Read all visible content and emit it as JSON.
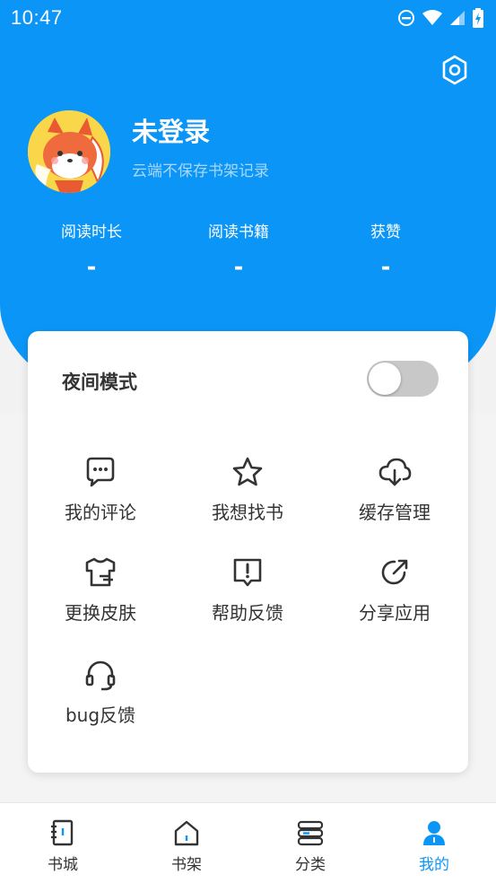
{
  "status_bar": {
    "time": "10:47"
  },
  "profile": {
    "username": "未登录",
    "subtitle": "云端不保存书架记录",
    "stats": [
      {
        "label": "阅读时长",
        "value": "-"
      },
      {
        "label": "阅读书籍",
        "value": "-"
      },
      {
        "label": "获赞",
        "value": "-"
      }
    ]
  },
  "card": {
    "night_mode_label": "夜间模式",
    "night_mode_on": false,
    "items": [
      {
        "label": "我的评论",
        "icon": "comment-icon"
      },
      {
        "label": "我想找书",
        "icon": "star-icon"
      },
      {
        "label": "缓存管理",
        "icon": "cloud-download-icon"
      },
      {
        "label": "更换皮肤",
        "icon": "shirt-icon"
      },
      {
        "label": "帮助反馈",
        "icon": "help-feedback-icon"
      },
      {
        "label": "分享应用",
        "icon": "share-icon"
      },
      {
        "label": "bug反馈",
        "icon": "headset-icon"
      }
    ]
  },
  "bottom_nav": {
    "items": [
      {
        "label": "书城",
        "icon": "bookstore-icon"
      },
      {
        "label": "书架",
        "icon": "bookshelf-icon"
      },
      {
        "label": "分类",
        "icon": "category-icon"
      },
      {
        "label": "我的",
        "icon": "profile-icon"
      }
    ],
    "active_index": 3
  },
  "colors": {
    "primary": "#0b96f7",
    "text": "#333333",
    "toggle_off": "#c8c8c8"
  }
}
